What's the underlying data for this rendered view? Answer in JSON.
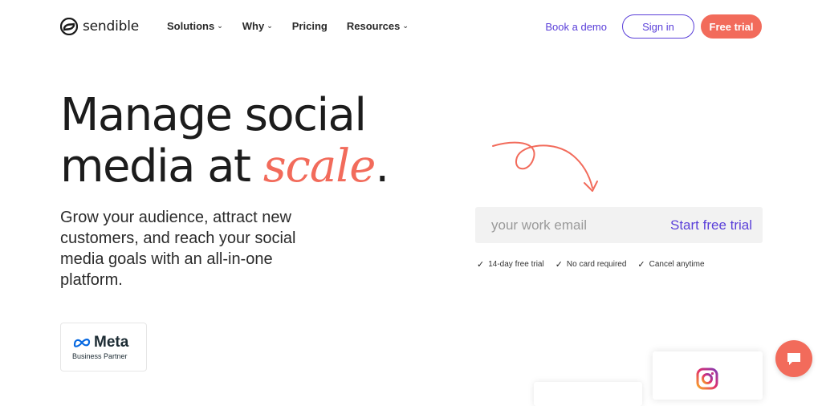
{
  "header": {
    "logo_text": "sendible",
    "nav": [
      {
        "label": "Solutions",
        "has_dropdown": true
      },
      {
        "label": "Why",
        "has_dropdown": true
      },
      {
        "label": "Pricing",
        "has_dropdown": false
      },
      {
        "label": "Resources",
        "has_dropdown": true
      }
    ],
    "book_demo": "Book a demo",
    "sign_in": "Sign in",
    "free_trial": "Free trial"
  },
  "hero": {
    "title_line1": "Manage social",
    "title_line2_prefix": "media at ",
    "title_accent": "scale",
    "title_suffix": ".",
    "subtitle": "Grow your audience, attract new customers, and reach your social media goals with an all-in-one platform."
  },
  "signup": {
    "email_placeholder": "your work email",
    "cta": "Start free trial",
    "perks": [
      "14-day free trial",
      "No card required",
      "Cancel anytime"
    ]
  },
  "badge": {
    "meta_word": "Meta",
    "meta_sub": "Business Partner"
  },
  "icons": {
    "chevron": "chevron-down-icon",
    "check": "check-icon",
    "chat": "chat-icon",
    "instagram": "instagram-icon"
  },
  "colors": {
    "accent": "#f26b5b",
    "brand_purple": "#5a3fd9",
    "input_bg": "#f2f2f2",
    "text": "#1c1c1c"
  }
}
